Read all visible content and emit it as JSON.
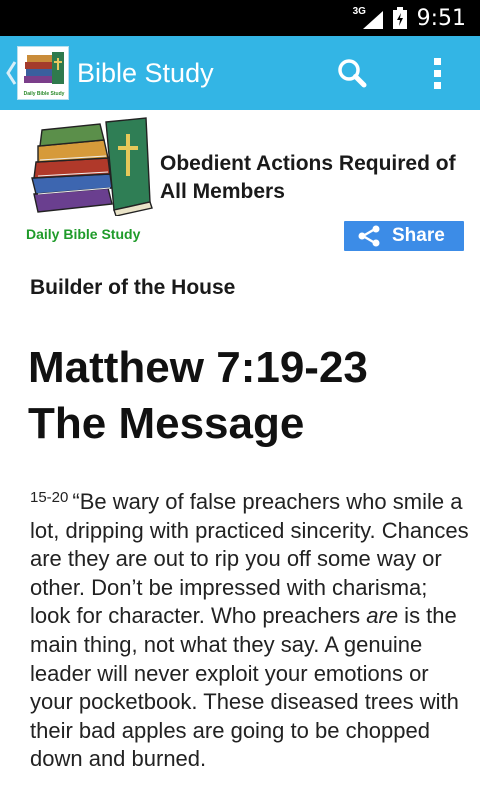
{
  "status_bar": {
    "network": "3G",
    "time": "9:51"
  },
  "action_bar": {
    "title": "Bible Study",
    "logo_caption": "Daily Bible Study",
    "icons": [
      "back-chevron-icon",
      "search-icon",
      "overflow-menu-icon"
    ]
  },
  "header": {
    "post_title": "Obedient Actions Required of All Members",
    "brand_caption": "Daily Bible Study",
    "share_label": "Share"
  },
  "article": {
    "subheading": "Builder of the House",
    "title_line1": "Matthew 7:19-23",
    "title_line2": "The Message",
    "verse_number": "15-20",
    "body_part1": "“Be wary of false preachers who smile a lot, dripping with practiced sincerity. Chances are they are out to rip you off some way or other. Don’t be impressed with charisma; look for character. Who preachers ",
    "body_emphasis": "are",
    "body_part2": " is the main thing, not what they say. A genuine leader will never exploit your emotions or your pocketbook. These diseased trees with their bad apples are going to be chopped down and burned."
  },
  "colors": {
    "action_bar": "#33b5e5",
    "share_button": "#3c8ce7",
    "brand_green": "#1f9b2a",
    "status_bar": "#000000"
  }
}
